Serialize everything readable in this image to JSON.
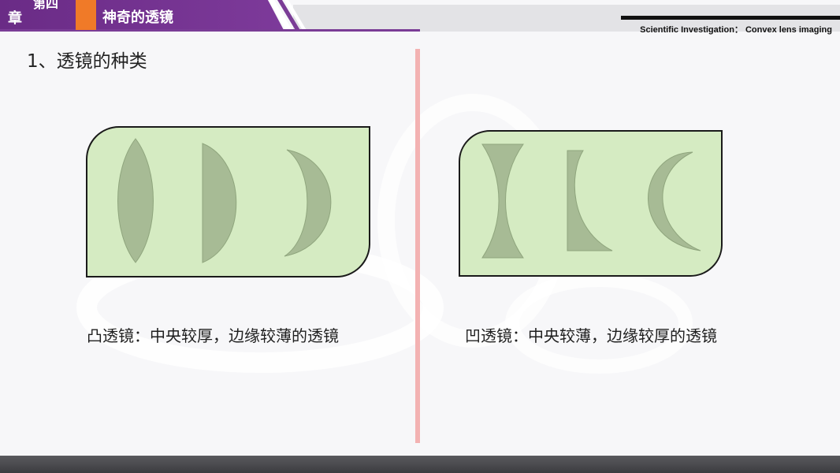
{
  "header": {
    "chapter_line1": "第四",
    "chapter_line2": "章",
    "title": "神奇的透镜",
    "subtitle": "Scientific Investigation： Convex lens imaging"
  },
  "section_title": "1、透镜的种类",
  "convex": {
    "caption": "凸透镜：中央较厚，边缘较薄的透镜"
  },
  "concave": {
    "caption": "凹透镜：中央较薄，边缘较厚的透镜"
  },
  "colors": {
    "panel_fill": "#d5ebc2",
    "lens_fill": "#a7bb95",
    "divider": "#f3b2b2",
    "header_purple": "#6a2b86",
    "header_orange": "#f07a28"
  }
}
